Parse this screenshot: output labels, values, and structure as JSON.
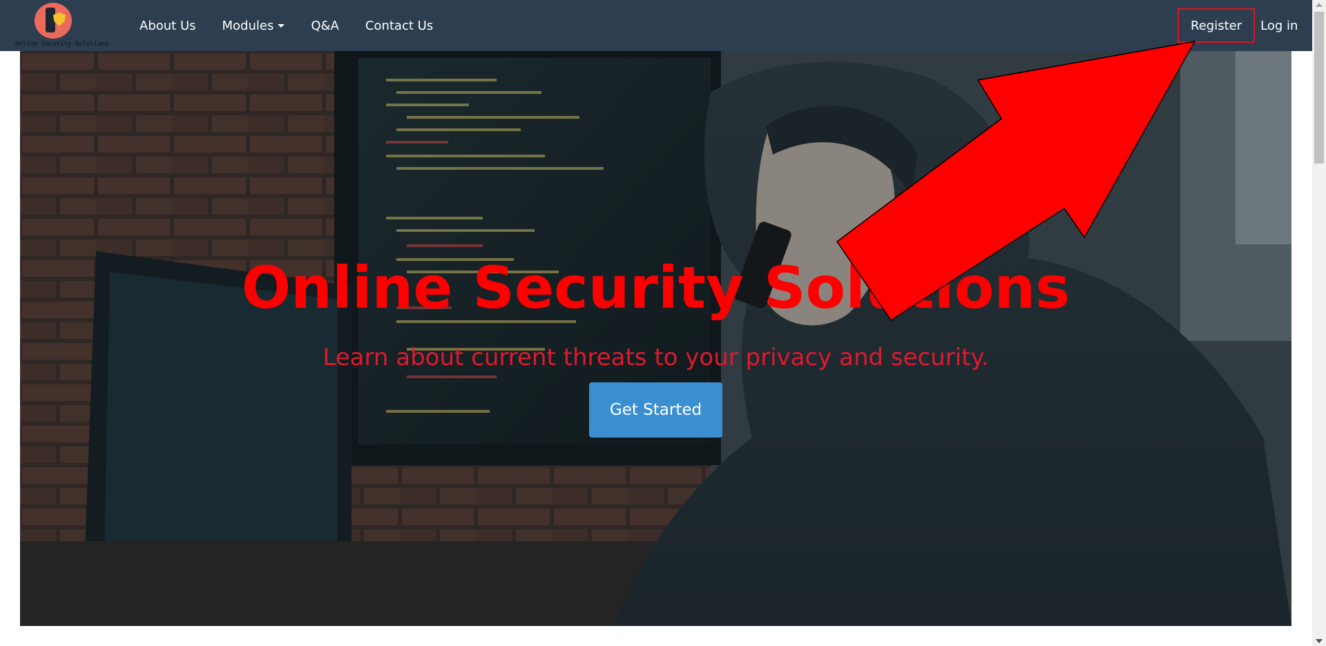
{
  "logo": {
    "text": "Online Security Solutions",
    "icon": "phone-shield-logo"
  },
  "nav": {
    "links": [
      {
        "label": "About Us"
      },
      {
        "label": "Modules",
        "icon": "caret-down-icon"
      },
      {
        "label": "Q&A"
      },
      {
        "label": "Contact Us"
      }
    ],
    "register_label": "Register",
    "login_label": "Log in"
  },
  "hero": {
    "title": "Online Security Solutions",
    "subtitle": "Learn about current threats to your privacy and security.",
    "cta_label": "Get Started",
    "background": "hooded-hacker-at-computer-photo"
  },
  "annotation": {
    "icon": "red-arrow-pointing-to-register"
  },
  "colors": {
    "navbar": "#2c3e50",
    "title": "#ff0000",
    "subtitle": "#e0192f",
    "cta": "#3a8fd0",
    "highlight": "#e0141f"
  }
}
